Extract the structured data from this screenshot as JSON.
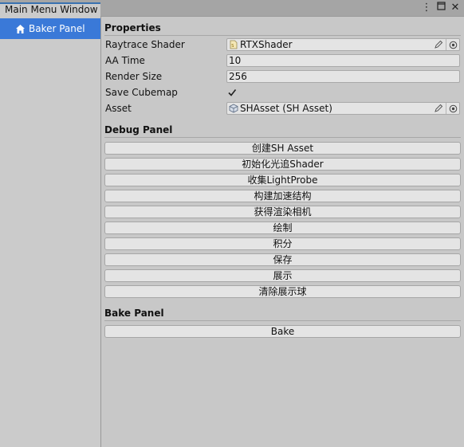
{
  "window": {
    "tab_title": "Main Menu Window"
  },
  "sidebar": {
    "items": [
      {
        "label": "Baker Panel",
        "icon": "home-icon",
        "selected": true
      }
    ]
  },
  "properties": {
    "header": "Properties",
    "rows": [
      {
        "label": "Raytrace Shader",
        "value": "RTXShader",
        "icon": "shader-file-icon"
      },
      {
        "label": "AA Time",
        "value": "10"
      },
      {
        "label": "Render Size",
        "value": "256"
      },
      {
        "label": "Save Cubemap",
        "checked": true
      },
      {
        "label": "Asset",
        "value": "SHAsset (SH Asset)",
        "icon": "scriptable-object-icon"
      }
    ]
  },
  "debug": {
    "header": "Debug Panel",
    "buttons": [
      "创建SH Asset",
      "初始化光追Shader",
      "收集LightProbe",
      "构建加速结构",
      "获得渲染相机",
      "绘制",
      "积分",
      "保存",
      "展示",
      "清除展示球"
    ]
  },
  "bake": {
    "header": "Bake Panel",
    "button": "Bake"
  },
  "colors": {
    "accent": "#3a79d8",
    "panel_bg": "#c8c8c8",
    "button_bg": "#e4e4e4",
    "tab_border": "#3a72b0"
  }
}
